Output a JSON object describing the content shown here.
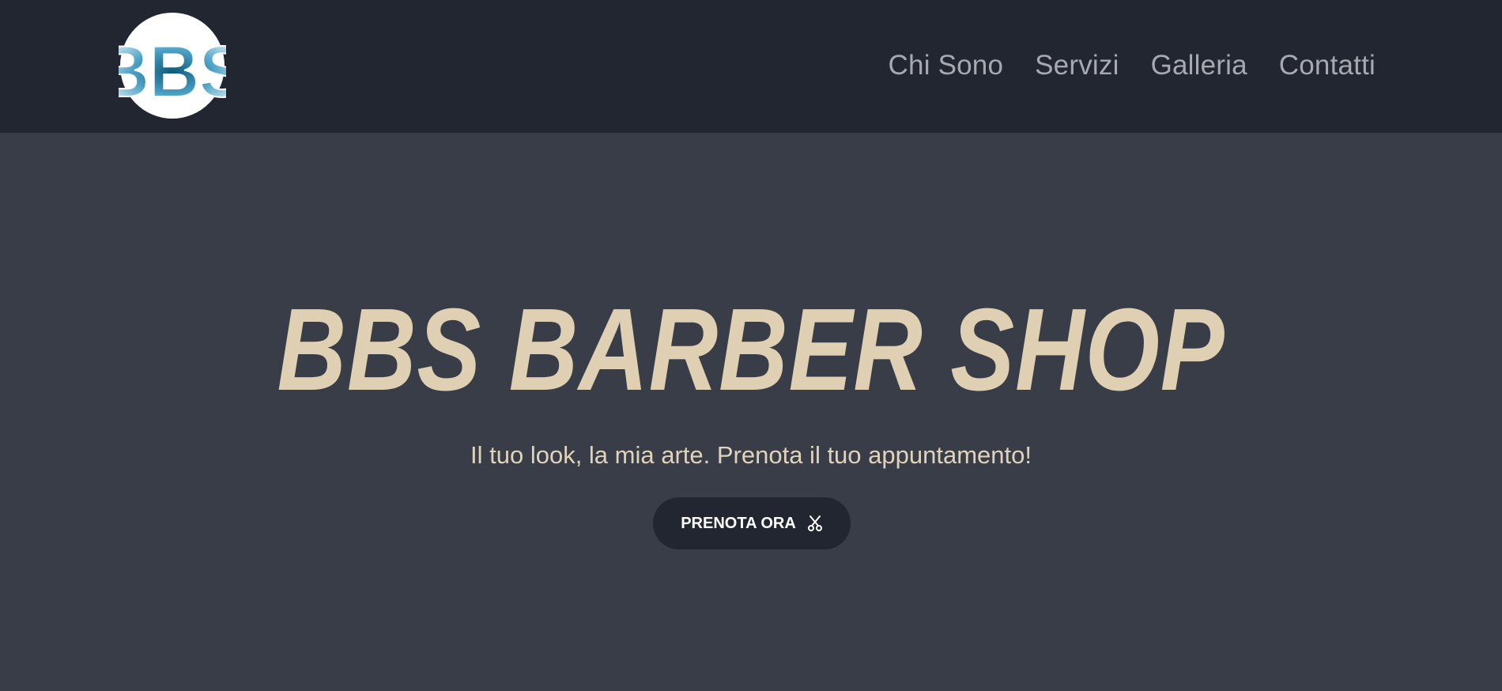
{
  "header": {
    "logo_text": "BBS",
    "nav": [
      {
        "label": "Chi Sono"
      },
      {
        "label": "Servizi"
      },
      {
        "label": "Galleria"
      },
      {
        "label": "Contatti"
      }
    ]
  },
  "hero": {
    "title": "BBS BARBER SHOP",
    "subtitle": "Il tuo look, la mia arte. Prenota il tuo appuntamento!",
    "cta_label": "PRENOTA ORA",
    "cta_icon": "scissors-icon"
  },
  "colors": {
    "header_bg": "#212631",
    "hero_bg": "#393d47",
    "accent": "#dfcfb3",
    "nav_text": "#a6a9b0"
  }
}
